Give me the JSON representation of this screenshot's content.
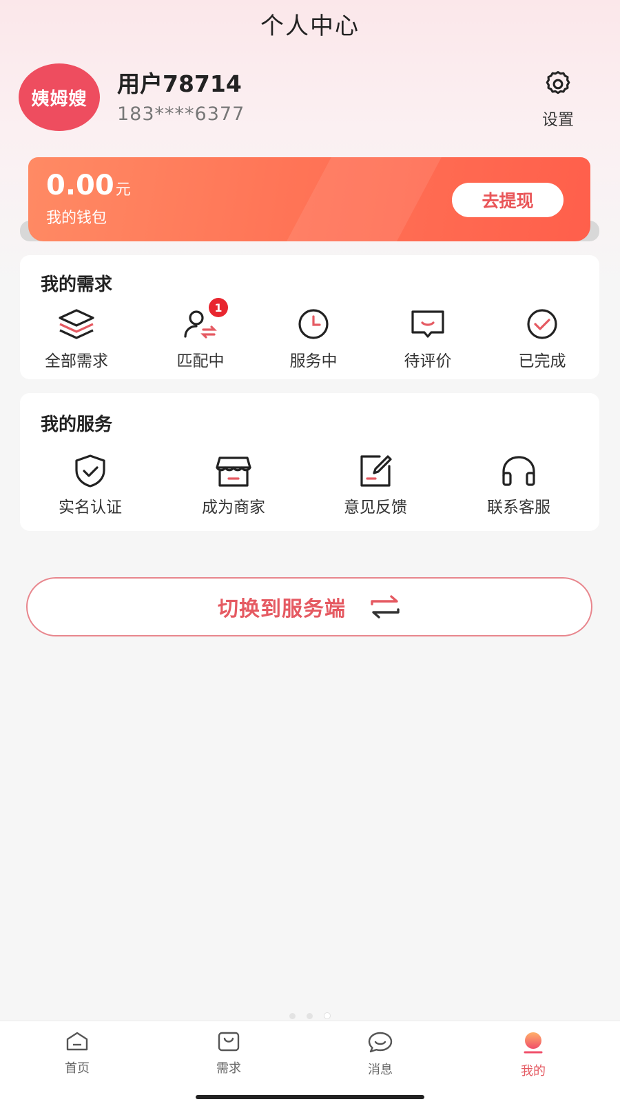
{
  "header": {
    "title": "个人中心"
  },
  "profile": {
    "avatar_text": "姨姆嫂",
    "username": "用户78714",
    "phone": "183****6377",
    "settings_label": "设置"
  },
  "wallet": {
    "amount": "0.00",
    "unit": "元",
    "label": "我的钱包",
    "withdraw_label": "去提现"
  },
  "my_demands": {
    "title": "我的需求",
    "items": [
      {
        "label": "全部需求",
        "icon": "layers-icon"
      },
      {
        "label": "匹配中",
        "icon": "user-swap-icon",
        "badge": "1"
      },
      {
        "label": "服务中",
        "icon": "clock-icon"
      },
      {
        "label": "待评价",
        "icon": "comment-icon"
      },
      {
        "label": "已完成",
        "icon": "check-circle-icon"
      }
    ]
  },
  "my_services": {
    "title": "我的服务",
    "items": [
      {
        "label": "实名认证",
        "icon": "shield-check-icon"
      },
      {
        "label": "成为商家",
        "icon": "store-icon"
      },
      {
        "label": "意见反馈",
        "icon": "edit-icon"
      },
      {
        "label": "联系客服",
        "icon": "headset-icon"
      }
    ]
  },
  "switch_button": {
    "label": "切换到服务端"
  },
  "tabbar": {
    "items": [
      {
        "label": "首页",
        "icon": "home-icon"
      },
      {
        "label": "需求",
        "icon": "bag-icon"
      },
      {
        "label": "消息",
        "icon": "chat-icon"
      },
      {
        "label": "我的",
        "icon": "profile-icon",
        "active": true
      }
    ]
  },
  "colors": {
    "accent": "#e55a62",
    "wallet_start": "#ff8a64",
    "wallet_end": "#ff5f4b",
    "badge": "#e8262f"
  }
}
